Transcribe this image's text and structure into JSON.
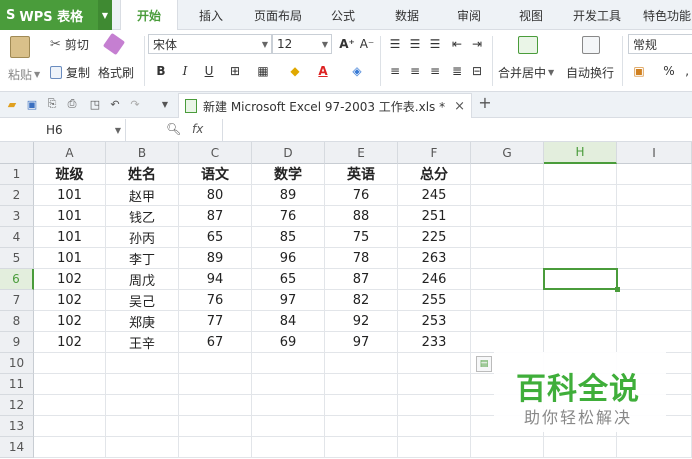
{
  "app": {
    "logo_text": "WPS 表格",
    "logo_glyph": "S"
  },
  "menu": {
    "tabs": [
      "开始",
      "插入",
      "页面布局",
      "公式",
      "数据",
      "审阅",
      "视图",
      "开发工具",
      "特色功能"
    ],
    "active": "开始"
  },
  "ribbon": {
    "paste_label": "粘贴",
    "cut_label": "剪切",
    "copy_label": "复制",
    "format_painter_label": "格式刷",
    "font_name": "宋体",
    "font_size": "12",
    "grow_font": "A⁺",
    "shrink_font": "A⁻",
    "bold": "B",
    "italic": "I",
    "underline": "U",
    "merge_center_label": "合并居中",
    "wrap_text_label": "自动换行",
    "number_format": "常规",
    "percent": "%",
    "comma": "‚"
  },
  "document": {
    "tab_title": "新建 Microsoft Excel 97-2003 工作表.xls *"
  },
  "formula_bar": {
    "cell_ref": "H6",
    "fx": "fx",
    "value": ""
  },
  "sheet": {
    "columns": [
      "A",
      "B",
      "C",
      "D",
      "E",
      "F",
      "G",
      "H",
      "I"
    ],
    "selected_column": "H",
    "rows": [
      "1",
      "2",
      "3",
      "4",
      "5",
      "6",
      "7",
      "8",
      "9",
      "10",
      "11",
      "12",
      "13",
      "14"
    ],
    "selected_row": "6",
    "cells": [
      [
        "班级",
        "姓名",
        "语文",
        "数学",
        "英语",
        "总分"
      ],
      [
        "101",
        "赵甲",
        "80",
        "89",
        "76",
        "245"
      ],
      [
        "101",
        "钱乙",
        "87",
        "76",
        "88",
        "251"
      ],
      [
        "101",
        "孙丙",
        "65",
        "85",
        "75",
        "225"
      ],
      [
        "101",
        "李丁",
        "89",
        "96",
        "78",
        "263"
      ],
      [
        "102",
        "周戊",
        "94",
        "65",
        "87",
        "246"
      ],
      [
        "102",
        "吴己",
        "76",
        "97",
        "82",
        "255"
      ],
      [
        "102",
        "郑庚",
        "77",
        "84",
        "92",
        "253"
      ],
      [
        "102",
        "王辛",
        "67",
        "69",
        "97",
        "233"
      ]
    ]
  },
  "watermark": {
    "title": "百科全说",
    "subtitle": "助你轻松解决"
  },
  "colors": {
    "accent": "#4a9c3b",
    "watermark": "#3fae3a"
  }
}
